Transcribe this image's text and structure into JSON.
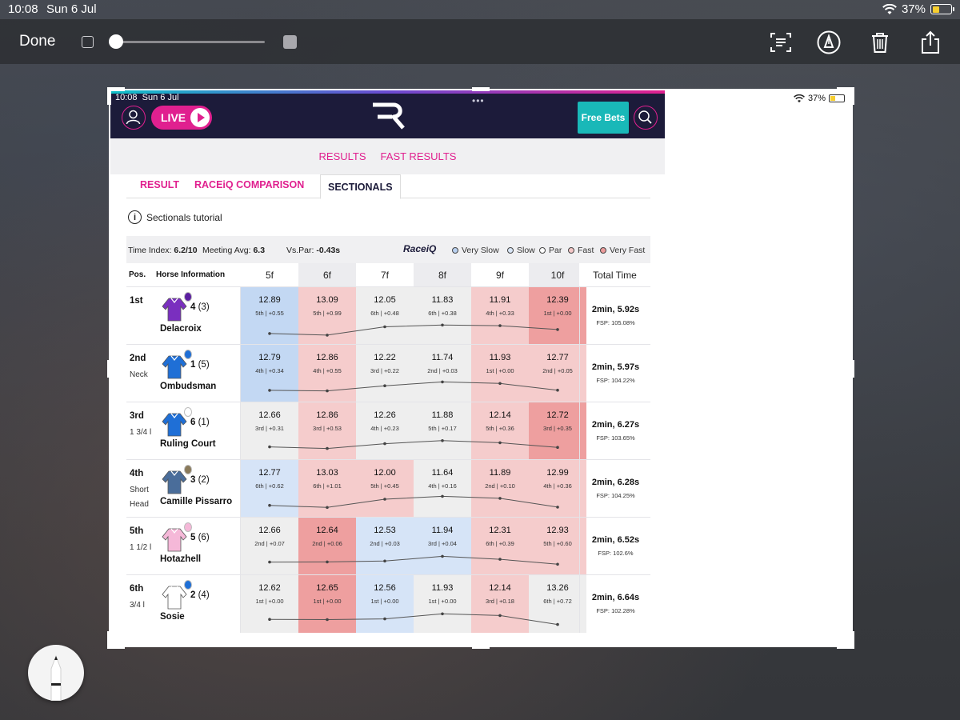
{
  "ios_status": {
    "time": "10:08",
    "date": "Sun 6 Jul",
    "battery": "37%"
  },
  "markup_toolbar": {
    "done_label": "Done"
  },
  "screenshot": {
    "status": {
      "time": "10:08",
      "date": "Sun 6 Jul",
      "battery": "37%"
    },
    "header": {
      "live_label": "LIVE",
      "free_bets_label": "Free Bets"
    },
    "sub_nav": [
      "RESULTS",
      "FAST RESULTS"
    ],
    "tabs": [
      "RESULT",
      "RACEiQ COMPARISON",
      "SECTIONALS"
    ],
    "tutorial_label": "Sectionals tutorial",
    "meta": {
      "time_index_label": "Time Index:",
      "time_index_value": "6.2/10",
      "meeting_avg_label": "Meeting Avg:",
      "meeting_avg_value": "6.3",
      "vs_par_label": "Vs.Par:",
      "vs_par_value": "-0.43s",
      "brand": "RaceiQ"
    },
    "legend": [
      {
        "label": "Very Slow",
        "color": "#b9d0f0"
      },
      {
        "label": "Slow",
        "color": "#d9e6f7"
      },
      {
        "label": "Par",
        "color": "#ffffff"
      },
      {
        "label": "Fast",
        "color": "#f4c7c7"
      },
      {
        "label": "Very Fast",
        "color": "#ec9a9a"
      }
    ],
    "columns": {
      "pos": "Pos.",
      "horse": "Horse Information",
      "sections": [
        "5f",
        "6f",
        "7f",
        "8f",
        "9f",
        "10f"
      ],
      "total": "Total Time"
    },
    "rows": [
      {
        "pos": "1st",
        "dist": [],
        "num": "4",
        "draw": "(3)",
        "name": "Delacroix",
        "silk_color": "#7a2fbf",
        "cap_color": "#5b1fa0",
        "cells": [
          {
            "t": "12.89",
            "s": "5th | +0.55",
            "c": "vslow"
          },
          {
            "t": "13.09",
            "s": "5th | +0.99",
            "c": "fast"
          },
          {
            "t": "12.05",
            "s": "6th | +0.48",
            "c": "par"
          },
          {
            "t": "11.83",
            "s": "6th | +0.38",
            "c": "par"
          },
          {
            "t": "11.91",
            "s": "4th | +0.33",
            "c": "fast"
          },
          {
            "t": "12.39",
            "s": "1st | +0.00",
            "c": "vfast"
          }
        ],
        "total": "2min, 5.92s",
        "fsp": "FSP: 105.08%"
      },
      {
        "pos": "2nd",
        "dist": [
          "Neck"
        ],
        "num": "1",
        "draw": "(5)",
        "name": "Ombudsman",
        "silk_color": "#1f6fd6",
        "cap_color": "#1f6fd6",
        "cells": [
          {
            "t": "12.79",
            "s": "4th | +0.34",
            "c": "vslow"
          },
          {
            "t": "12.86",
            "s": "4th | +0.55",
            "c": "fast"
          },
          {
            "t": "12.22",
            "s": "3rd | +0.22",
            "c": "par"
          },
          {
            "t": "11.74",
            "s": "2nd | +0.03",
            "c": "par"
          },
          {
            "t": "11.93",
            "s": "1st | +0.00",
            "c": "fast"
          },
          {
            "t": "12.77",
            "s": "2nd | +0.05",
            "c": "fast"
          }
        ],
        "total": "2min, 5.97s",
        "fsp": "FSP: 104.22%"
      },
      {
        "pos": "3rd",
        "dist": [
          "1 3/4 l"
        ],
        "num": "6",
        "draw": "(1)",
        "name": "Ruling Court",
        "silk_color": "#1f6fd6",
        "cap_color": "#ffffff",
        "cells": [
          {
            "t": "12.66",
            "s": "3rd | +0.31",
            "c": "par"
          },
          {
            "t": "12.86",
            "s": "3rd | +0.53",
            "c": "fast"
          },
          {
            "t": "12.26",
            "s": "4th | +0.23",
            "c": "par"
          },
          {
            "t": "11.88",
            "s": "5th | +0.17",
            "c": "par"
          },
          {
            "t": "12.14",
            "s": "5th | +0.36",
            "c": "fast"
          },
          {
            "t": "12.72",
            "s": "3rd | +0.35",
            "c": "vfast"
          }
        ],
        "total": "2min, 6.27s",
        "fsp": "FSP: 103.65%"
      },
      {
        "pos": "4th",
        "dist": [
          "Short",
          "Head"
        ],
        "num": "3",
        "draw": "(2)",
        "name": "Camille Pissarro",
        "silk_color": "#4a6d9a",
        "cap_color": "#8a7a5a",
        "cells": [
          {
            "t": "12.77",
            "s": "6th | +0.62",
            "c": "slow"
          },
          {
            "t": "13.03",
            "s": "6th | +1.01",
            "c": "fast"
          },
          {
            "t": "12.00",
            "s": "5th | +0.45",
            "c": "fast"
          },
          {
            "t": "11.64",
            "s": "4th | +0.16",
            "c": "par"
          },
          {
            "t": "11.89",
            "s": "2nd | +0.10",
            "c": "fast"
          },
          {
            "t": "12.99",
            "s": "4th | +0.36",
            "c": "fast"
          }
        ],
        "total": "2min, 6.28s",
        "fsp": "FSP: 104.25%"
      },
      {
        "pos": "5th",
        "dist": [
          "1 1/2 l"
        ],
        "num": "5",
        "draw": "(6)",
        "name": "Hotazhell",
        "silk_color": "#f5b8d8",
        "cap_color": "#f5b8d8",
        "cells": [
          {
            "t": "12.66",
            "s": "2nd | +0.07",
            "c": "par"
          },
          {
            "t": "12.64",
            "s": "2nd | +0.06",
            "c": "vfast"
          },
          {
            "t": "12.53",
            "s": "2nd | +0.03",
            "c": "slow"
          },
          {
            "t": "11.94",
            "s": "3rd | +0.04",
            "c": "slow"
          },
          {
            "t": "12.31",
            "s": "6th | +0.39",
            "c": "fast"
          },
          {
            "t": "12.93",
            "s": "5th | +0.60",
            "c": "fast"
          }
        ],
        "total": "2min, 6.52s",
        "fsp": "FSP: 102.6%"
      },
      {
        "pos": "6th",
        "dist": [
          "3/4 l"
        ],
        "num": "2",
        "draw": "(4)",
        "name": "Sosie",
        "silk_color": "#ffffff",
        "cap_color": "#1f6fd6",
        "cells": [
          {
            "t": "12.62",
            "s": "1st | +0.00",
            "c": "par"
          },
          {
            "t": "12.65",
            "s": "1st | +0.00",
            "c": "vfast"
          },
          {
            "t": "12.56",
            "s": "1st | +0.00",
            "c": "slow"
          },
          {
            "t": "11.93",
            "s": "1st | +0.00",
            "c": "par"
          },
          {
            "t": "12.14",
            "s": "3rd | +0.18",
            "c": "fast"
          },
          {
            "t": "13.26",
            "s": "6th | +0.72",
            "c": "par"
          }
        ],
        "total": "2min, 6.64s",
        "fsp": "FSP: 102.28%"
      }
    ]
  },
  "colors": {
    "brand_pink": "#e0208f",
    "brand_navy": "#1c1b3a",
    "teal": "#19b8b8",
    "vslow": "#c3d8f3",
    "slow": "#d6e4f7",
    "par": "#eeeeee",
    "fast": "#f5cccc",
    "vfast": "#ee9f9f"
  }
}
